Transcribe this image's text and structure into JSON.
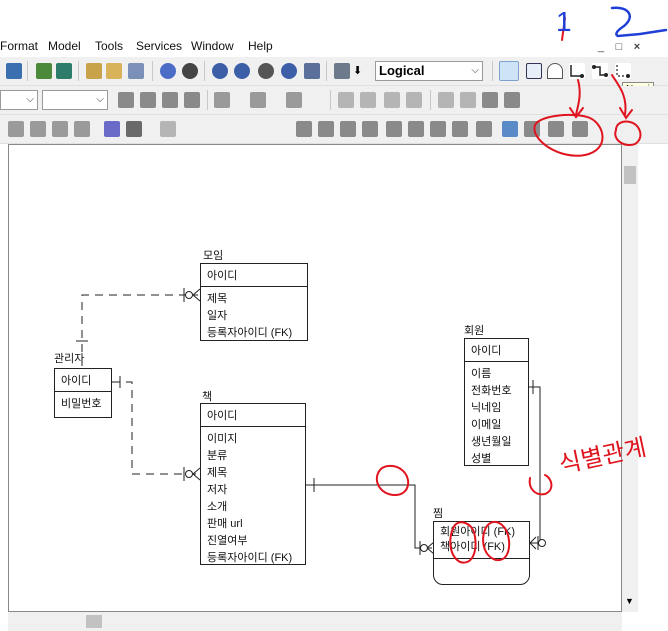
{
  "menu": [
    "Format",
    "Model",
    "Tools",
    "Services",
    "Window",
    "Help"
  ],
  "window_buttons": [
    "_",
    "□",
    "×"
  ],
  "model_view": "Logical",
  "tooltip": "Non-i",
  "annotations": {
    "num1": "1",
    "num2": "2",
    "circle_text": "O",
    "handwriting": "식별관계"
  },
  "entities": {
    "moim": {
      "title": "모임",
      "pk": [
        "아이디"
      ],
      "attrs": [
        "제목",
        "일자",
        "등록자아이디 (FK)"
      ]
    },
    "admin": {
      "title": "관리자",
      "pk": [
        "아이디"
      ],
      "attrs": [
        "비밀번호"
      ]
    },
    "book": {
      "title": "책",
      "pk": [
        "아이디"
      ],
      "attrs": [
        "이미지",
        "분류",
        "제목",
        "저자",
        "소개",
        "판매 url",
        "진열여부",
        "등록자아이디 (FK)"
      ]
    },
    "member": {
      "title": "회원",
      "pk": [
        "아이디"
      ],
      "attrs": [
        "이름",
        "전화번호",
        "닉네임",
        "이메일",
        "생년월일",
        "성별"
      ]
    },
    "jjim": {
      "title": "찜",
      "pk": [
        "회원아이디 (FK)",
        "책아이디 (FK)"
      ],
      "attrs": []
    }
  },
  "colors": {
    "annotation": "#e0141e",
    "toolbar_bg": "#f0f0f0"
  }
}
